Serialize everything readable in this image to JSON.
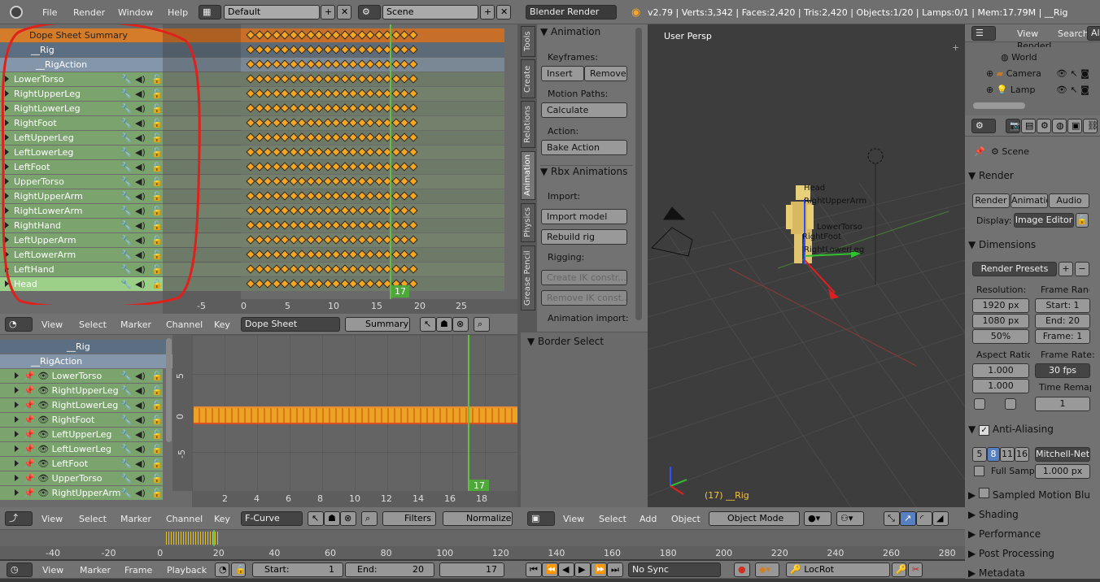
{
  "top_bar": {
    "menus": [
      "File",
      "Render",
      "Window",
      "Help"
    ],
    "layout": "Default",
    "scene": "Scene",
    "engine": "Blender Render",
    "stats": "v2.79 | Verts:3,342 | Faces:2,420 | Tris:2,420 | Objects:1/20 | Lamps:0/1 | Mem:17.79M | __Rig"
  },
  "dopesheet": {
    "summary": "Dope Sheet Summary",
    "rig": "__Rig",
    "action": "__RigAction",
    "channels": [
      "LowerTorso",
      "RightUpperLeg",
      "RightLowerLeg",
      "RightFoot",
      "LeftUpperLeg",
      "LeftLowerLeg",
      "LeftFoot",
      "UpperTorso",
      "RightUpperArm",
      "RightLowerArm",
      "RightHand",
      "LeftUpperArm",
      "LeftLowerArm",
      "LeftHand",
      "Head"
    ],
    "current_frame": "17",
    "ruler": [
      "-5",
      "0",
      "5",
      "10",
      "15",
      "20",
      "25"
    ],
    "header": {
      "menus": [
        "View",
        "Select",
        "Marker",
        "Channel",
        "Key"
      ],
      "mode": "Dope Sheet",
      "summary_btn": "Summary"
    }
  },
  "graph": {
    "rig": "__Rig",
    "action": "__RigAction",
    "channels": [
      "LowerTorso",
      "RightUpperLeg",
      "RightLowerLeg",
      "RightFoot",
      "LeftUpperLeg",
      "LeftLowerLeg",
      "LeftFoot",
      "UpperTorso",
      "RightUpperArm"
    ],
    "y_ticks": [
      "5",
      "0",
      "-5"
    ],
    "x_ticks": [
      "2",
      "4",
      "6",
      "8",
      "10",
      "12",
      "14",
      "16",
      "18"
    ],
    "current_frame": "17",
    "header": {
      "menus": [
        "View",
        "Select",
        "Marker",
        "Channel",
        "Key"
      ],
      "mode": "F-Curve",
      "filters": "Filters",
      "normalize": "Normalize"
    }
  },
  "toolshelf": {
    "tabs": [
      "Tools",
      "Create",
      "Relations",
      "Animation",
      "Physics",
      "Grease Pencil"
    ],
    "animation_panel": "Animation",
    "keyframes_label": "Keyframes:",
    "insert": "Insert",
    "remove": "Remove",
    "motion_paths_label": "Motion Paths:",
    "calculate": "Calculate",
    "action_label": "Action:",
    "bake_action": "Bake Action",
    "rbx_panel": "Rbx Animations",
    "import_label": "Import:",
    "import_model": "Import model",
    "rebuild_rig": "Rebuild rig",
    "rigging_label": "Rigging:",
    "create_ik": "Create IK constr...",
    "remove_ik": "Remove IK const...",
    "anim_import_label": "Animation import:",
    "border_select": "Border Select"
  },
  "viewport": {
    "label": "User Persp",
    "object_label": "(17) __Rig",
    "bone_labels": [
      "Head",
      "RightUpperArm",
      "RightLowerLeg",
      "LowerTorso",
      "RightFoot"
    ],
    "header": {
      "menus": [
        "View",
        "Select",
        "Add",
        "Object"
      ],
      "mode": "Object Mode"
    }
  },
  "outliner": {
    "menus": [
      "View",
      "Search"
    ],
    "all": "All",
    "items": [
      "RenderL",
      "World",
      "Camera",
      "Lamp"
    ]
  },
  "properties": {
    "scene": "Scene",
    "render_panel": "Render",
    "render_btn": "Render",
    "anim_btn": "Animation",
    "audio_btn": "Audio",
    "display_label": "Display:",
    "display_value": "Image Editor",
    "dimensions_panel": "Dimensions",
    "render_presets": "Render Presets",
    "resolution_label": "Resolution:",
    "res_x": "1920 px",
    "res_y": "1080 px",
    "res_pct": "50%",
    "frame_range_label": "Frame Range:",
    "start": "Start: 1",
    "end": "End: 20",
    "step": "Frame: 1",
    "aspect_label": "Aspect Ratio:",
    "aspect_x": "1.000",
    "aspect_y": "1.000",
    "frame_rate_label": "Frame Rate:",
    "fps": "30 fps",
    "time_remap_label": "Time Remapping:",
    "time_remap": "1",
    "aa_panel": "Anti-Aliasing",
    "aa_samples": [
      "5",
      "8",
      "11",
      "16"
    ],
    "aa_filter": "Mitchell-Netravali",
    "full_sample": "Full Sample",
    "filter_size": "1.000 px",
    "sampled_motion_blur": "Sampled Motion Blur",
    "shading": "Shading",
    "performance": "Performance",
    "post_processing": "Post Processing",
    "metadata": "Metadata"
  },
  "timeline": {
    "ticks": [
      "-40",
      "-20",
      "0",
      "20",
      "40",
      "60",
      "80",
      "100",
      "120",
      "140",
      "160",
      "180",
      "200",
      "220",
      "240",
      "260",
      "280"
    ],
    "menus": [
      "View",
      "Marker",
      "Frame",
      "Playback"
    ],
    "start": "Start:",
    "start_val": "1",
    "end": "End:",
    "end_val": "20",
    "current": "17",
    "sync": "No Sync",
    "keying_set": "LocRot"
  },
  "colors": {
    "annotation": "#e0201a",
    "keyframe": "#f5a623",
    "playhead": "#60c040",
    "channel_group": "#7ba36d"
  }
}
